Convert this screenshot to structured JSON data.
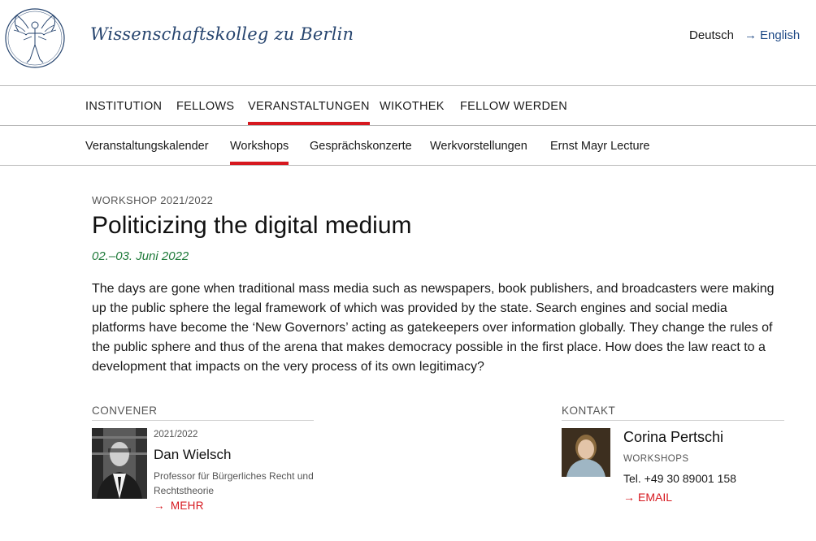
{
  "header": {
    "logo_text": "Wissenschaftskolleg zu Berlin",
    "lang_de": "Deutsch",
    "lang_en": "English",
    "lang_arrow": "→"
  },
  "main_nav": [
    {
      "label": "INSTITUTION",
      "active": false
    },
    {
      "label": "FELLOWS",
      "active": false
    },
    {
      "label": "VERANSTALTUNGEN",
      "active": true
    },
    {
      "label": "WIKOTHEK",
      "active": false
    },
    {
      "label": "FELLOW WERDEN",
      "active": false
    }
  ],
  "sub_nav": [
    {
      "label": "Veranstaltungskalender",
      "active": false
    },
    {
      "label": "Workshops",
      "active": true
    },
    {
      "label": "Gesprächskonzerte",
      "active": false
    },
    {
      "label": "Werkvorstellungen",
      "active": false
    },
    {
      "label": "Ernst Mayr Lecture",
      "active": false
    }
  ],
  "event": {
    "kicker": "WORKSHOP 2021/2022",
    "title": "Politicizing the digital medium",
    "dates": "02.–03. Juni 2022",
    "description": "The days are gone when traditional mass media such as newspapers, book publishers, and broadcasters were making up the public sphere the legal framework of which was provided by the state. Search engines and social media platforms have become the ‘New Governors’ acting as gatekeepers over information globally. They change the rules of the public sphere and thus of the arena that makes democracy possible in the first place. How does the law react to a development that impacts on the very process of its own legitimacy?"
  },
  "convener": {
    "heading": "CONVENER",
    "year": "2021/2022",
    "name": "Dan Wielsch",
    "role": "Professor für Bürgerliches Recht und Rechtstheorie",
    "more_label": "MEHR",
    "arrow": "→"
  },
  "kontakt": {
    "heading": "KONTAKT",
    "name": "Corina Pertschi",
    "department": "WORKSHOPS",
    "tel": "Tel. +49 30 89001 158",
    "email_label": "EMAIL",
    "arrow": "→"
  },
  "colors": {
    "accent_red": "#d6181f",
    "brand_blue": "#27456f",
    "date_green": "#1f7a3a"
  }
}
